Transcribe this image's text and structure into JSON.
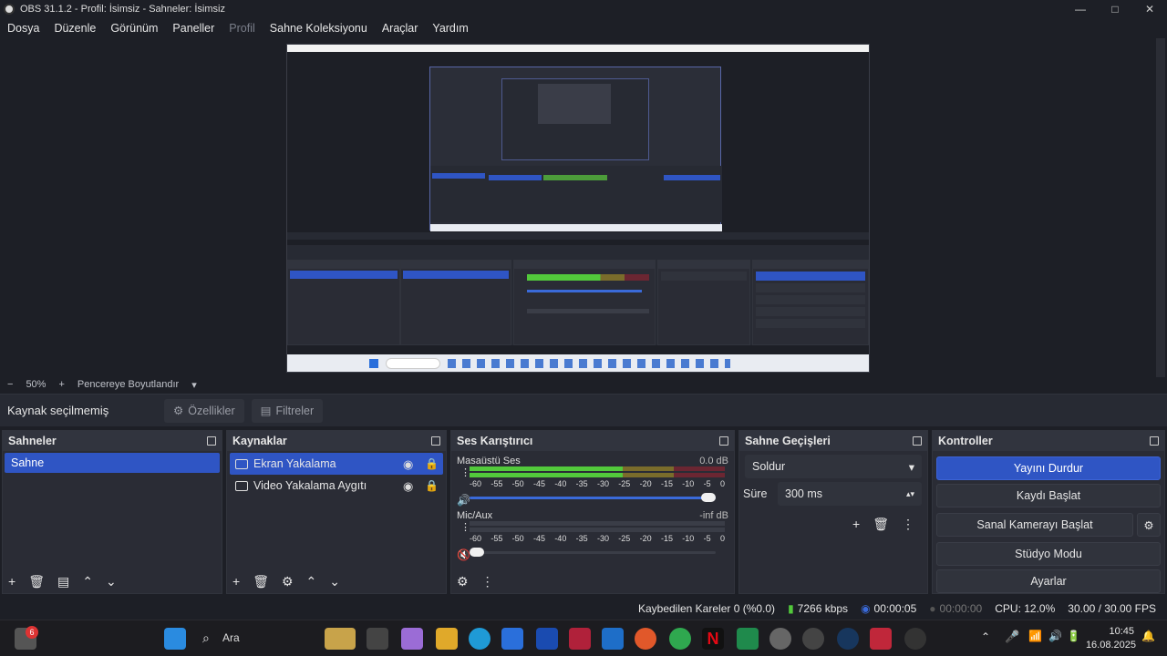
{
  "window": {
    "title": "OBS 31.1.2 - Profil: İsimsiz - Sahneler: İsimsiz",
    "controls": [
      "—",
      "□",
      "✕"
    ]
  },
  "menu": [
    "Dosya",
    "Düzenle",
    "Görünüm",
    "Paneller",
    "Profil",
    "Sahne Koleksiyonu",
    "Araçlar",
    "Yardım"
  ],
  "zoom": {
    "minus": "−",
    "percent": "50%",
    "plus": "+",
    "mode": "Pencereye Boyutlandır"
  },
  "context": {
    "no_source": "Kaynak seçilmemiş",
    "properties": "Özellikler",
    "filters": "Filtreler"
  },
  "scenes": {
    "title": "Sahneler",
    "items": [
      "Sahne"
    ]
  },
  "sources": {
    "title": "Kaynaklar",
    "items": [
      {
        "name": "Ekran Yakalama",
        "selected": true
      },
      {
        "name": "Video Yakalama Aygıtı",
        "selected": false
      }
    ]
  },
  "mixer": {
    "title": "Ses Karıştırıcı",
    "channels": [
      {
        "name": "Masaüstü Ses",
        "level": "0.0 dB",
        "volume": 1.0,
        "meter_fill": 0.6,
        "muted": false
      },
      {
        "name": "Mic/Aux",
        "level": "-inf dB",
        "volume": 0.0,
        "meter_fill": 0.0,
        "muted": true
      }
    ],
    "ticks": [
      "-60",
      "-55",
      "-50",
      "-45",
      "-40",
      "-35",
      "-30",
      "-25",
      "-20",
      "-15",
      "-10",
      "-5",
      "0"
    ]
  },
  "transitions": {
    "title": "Sahne Geçişleri",
    "selected": "Soldur",
    "duration_label": "Süre",
    "duration_value": "300 ms"
  },
  "controls": {
    "title": "Kontroller",
    "stop_stream": "Yayını Durdur",
    "start_record": "Kaydı Başlat",
    "virtual_cam": "Sanal Kamerayı Başlat",
    "studio_mode": "Stüdyo Modu",
    "settings": "Ayarlar"
  },
  "status": {
    "dropped": "Kaybedilen Kareler 0 (%0.0)",
    "bitrate": "7266 kbps",
    "stream_time": "00:00:05",
    "record_time": "00:00:00",
    "cpu": "CPU: 12.0%",
    "fps": "30.00 / 30.00 FPS"
  },
  "taskbar": {
    "search": "Ara",
    "notification_count": "6",
    "time": "10:45",
    "date": "16.08.2025"
  },
  "colors": {
    "accent": "#2f55c4",
    "bg": "#1d1f26",
    "panel": "#2a2c35"
  }
}
